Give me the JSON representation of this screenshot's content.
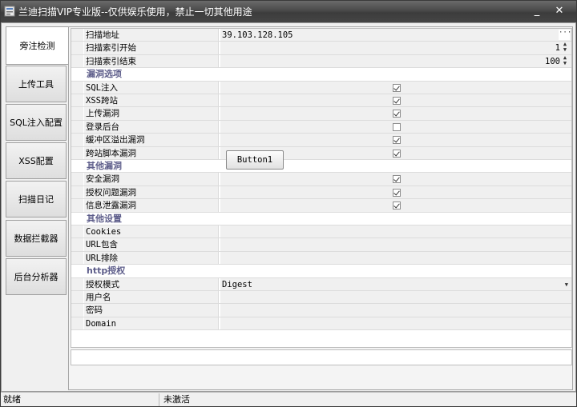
{
  "window": {
    "title": "兰迪扫描VIP专业版--仅供娱乐使用，禁止一切其他用途",
    "min_glyph": "_",
    "close_glyph": "✕"
  },
  "sidebar": {
    "tabs": [
      {
        "label": "旁注检测",
        "active": true
      },
      {
        "label": "上传工具",
        "active": false
      },
      {
        "label": "SQL注入配置",
        "active": false
      },
      {
        "label": "XSS配置",
        "active": false
      },
      {
        "label": "扫描日记",
        "active": false
      },
      {
        "label": "数据拦截器",
        "active": false
      },
      {
        "label": "后台分析器",
        "active": false
      }
    ]
  },
  "grid": {
    "rows": [
      {
        "type": "field",
        "name": "扫描地址",
        "value": "39.103.128.105",
        "editor": "ellipsis"
      },
      {
        "type": "field",
        "name": "扫描索引开始",
        "value": "1",
        "editor": "spin"
      },
      {
        "type": "field",
        "name": "扫描索引结束",
        "value": "100",
        "editor": "spin"
      },
      {
        "type": "category",
        "name": "漏洞选项"
      },
      {
        "type": "check",
        "name": "SQL注入",
        "checked": true
      },
      {
        "type": "check",
        "name": "XSS跨站",
        "checked": true
      },
      {
        "type": "check",
        "name": "上传漏洞",
        "checked": true
      },
      {
        "type": "check",
        "name": "登录后台",
        "checked": false
      },
      {
        "type": "check",
        "name": "缓冲区溢出漏洞",
        "checked": true
      },
      {
        "type": "check",
        "name": "跨站脚本漏洞",
        "checked": true
      },
      {
        "type": "category",
        "name": "其他漏洞"
      },
      {
        "type": "check",
        "name": "安全漏洞",
        "checked": true
      },
      {
        "type": "check",
        "name": "授权问题漏洞",
        "checked": true
      },
      {
        "type": "check",
        "name": "信息泄露漏洞",
        "checked": true
      },
      {
        "type": "category",
        "name": "其他设置"
      },
      {
        "type": "field",
        "name": "Cookies",
        "value": ""
      },
      {
        "type": "field",
        "name": "URL包含",
        "value": ""
      },
      {
        "type": "field",
        "name": "URL排除",
        "value": ""
      },
      {
        "type": "category",
        "name": "http授权"
      },
      {
        "type": "field",
        "name": "授权模式",
        "value": "Digest",
        "editor": "dropdown"
      },
      {
        "type": "field",
        "name": "用户名",
        "value": ""
      },
      {
        "type": "field",
        "name": "密码",
        "value": ""
      },
      {
        "type": "field",
        "name": "Domain",
        "value": ""
      }
    ]
  },
  "button1": {
    "label": "Button1"
  },
  "statusbar": {
    "left": "就绪",
    "right": "未激活"
  },
  "icons": {
    "ellipsis": "···",
    "spin_up": "▲",
    "spin_down": "▼",
    "dropdown": "▼"
  }
}
